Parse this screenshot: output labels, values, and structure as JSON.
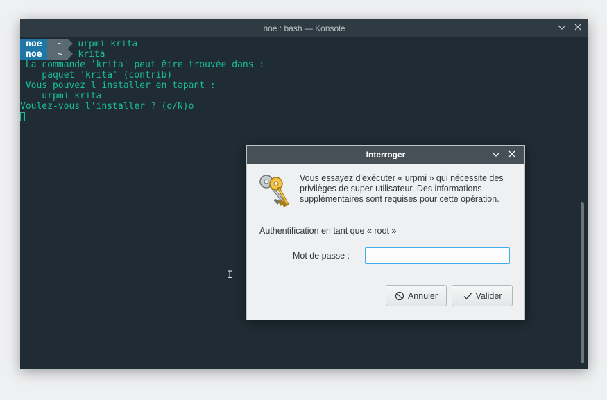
{
  "window": {
    "title": "noe : bash — Konsole"
  },
  "terminal": {
    "prompts": [
      {
        "user": "noe",
        "dir": "~",
        "command": "urpmi krita"
      },
      {
        "user": "noe",
        "dir": "~",
        "command": "krita"
      }
    ],
    "output": [
      " La commande 'krita' peut être trouvée dans :",
      "    paquet 'krita' (contrib)",
      " Vous pouvez l'installer en tapant :",
      "    urpmi krita",
      "Voulez-vous l'installer ? (o/N)o"
    ]
  },
  "dialog": {
    "title": "Interroger",
    "message": "Vous essayez d'exécuter « urpmi » qui nécessite des privilèges de super-utilisateur. Des informations supplémentaires sont requises pour cette opération.",
    "auth_text": "Authentification en tant que « root »",
    "password_label": "Mot de passe :",
    "password_value": "",
    "cancel_label": "Annuler",
    "ok_label": "Valider"
  },
  "icons": {
    "keys": "keys-icon",
    "minimize": "chevron-down-icon",
    "close": "close-icon",
    "cancel": "cancel-icon",
    "ok": "checkmark-icon"
  },
  "colors": {
    "terminal_bg": "#1f2c33",
    "terminal_text": "#1abc9c",
    "prompt_user_bg": "#1f77a8",
    "prompt_dir_bg": "#5a6a72",
    "dialog_title_bg": "#475057",
    "focus_accent": "#3daee9"
  }
}
